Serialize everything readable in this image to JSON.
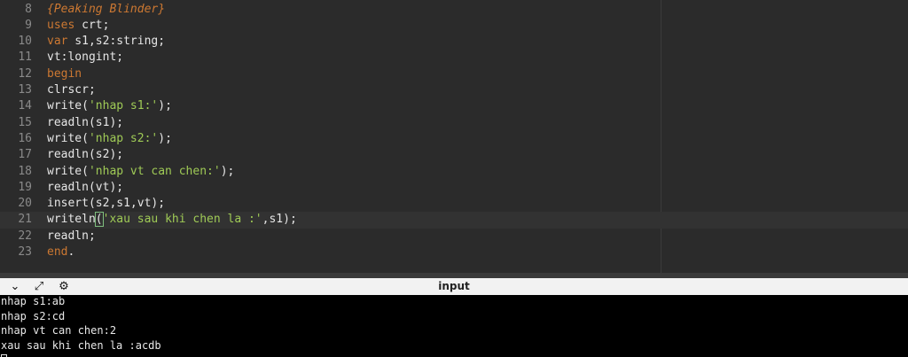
{
  "editor": {
    "lines": [
      {
        "num": "8",
        "tokens": [
          {
            "t": "{Peaking Blinder}",
            "c": "comment"
          }
        ]
      },
      {
        "num": "9",
        "tokens": [
          {
            "t": "uses",
            "c": "kw"
          },
          {
            "t": " crt;",
            "c": "default"
          }
        ]
      },
      {
        "num": "10",
        "tokens": [
          {
            "t": "var",
            "c": "kw"
          },
          {
            "t": " s1,s2:string;",
            "c": "default"
          }
        ]
      },
      {
        "num": "11",
        "tokens": [
          {
            "t": "vt:longint;",
            "c": "default"
          }
        ]
      },
      {
        "num": "12",
        "tokens": [
          {
            "t": "begin",
            "c": "kw"
          }
        ]
      },
      {
        "num": "13",
        "tokens": [
          {
            "t": "clrscr;",
            "c": "default"
          }
        ]
      },
      {
        "num": "14",
        "tokens": [
          {
            "t": "write(",
            "c": "default"
          },
          {
            "t": "'nhap s1:'",
            "c": "str"
          },
          {
            "t": ");",
            "c": "default"
          }
        ]
      },
      {
        "num": "15",
        "tokens": [
          {
            "t": "readln(s1);",
            "c": "default"
          }
        ]
      },
      {
        "num": "16",
        "tokens": [
          {
            "t": "write(",
            "c": "default"
          },
          {
            "t": "'nhap s2:'",
            "c": "str"
          },
          {
            "t": ");",
            "c": "default"
          }
        ]
      },
      {
        "num": "17",
        "tokens": [
          {
            "t": "readln(s2);",
            "c": "default"
          }
        ]
      },
      {
        "num": "18",
        "tokens": [
          {
            "t": "write(",
            "c": "default"
          },
          {
            "t": "'nhap vt can chen:'",
            "c": "str"
          },
          {
            "t": ");",
            "c": "default"
          }
        ]
      },
      {
        "num": "19",
        "tokens": [
          {
            "t": "readln(vt);",
            "c": "default"
          }
        ]
      },
      {
        "num": "20",
        "tokens": [
          {
            "t": "insert(s2,s1,vt);",
            "c": "default"
          }
        ]
      },
      {
        "num": "21",
        "active": true,
        "tokens": [
          {
            "t": "writeln",
            "c": "default"
          },
          {
            "t": "(",
            "c": "bracket"
          },
          {
            "t": "'xau sau khi chen la :'",
            "c": "str"
          },
          {
            "t": ",s1);",
            "c": "default"
          }
        ]
      },
      {
        "num": "22",
        "tokens": [
          {
            "t": "readln;",
            "c": "default"
          }
        ]
      },
      {
        "num": "23",
        "tokens": [
          {
            "t": "end",
            "c": "kw"
          },
          {
            "t": ".",
            "c": "default"
          }
        ]
      }
    ]
  },
  "panel": {
    "title": "input",
    "icons": [
      {
        "name": "chevron-down-icon",
        "glyph": "⌄"
      },
      {
        "name": "expand-icon",
        "glyph": "⤢"
      },
      {
        "name": "settings-icon",
        "glyph": "⚙"
      }
    ]
  },
  "terminal": {
    "lines": [
      "nhap s1:ab",
      "nhap s2:cd",
      "nhap vt can chen:2",
      "xau sau khi chen la :acdb"
    ]
  },
  "colors": {
    "editor_bg": "#2b2b2b",
    "keyword": "#cc7832",
    "string": "#9fca56",
    "text": "#e6e6e6",
    "terminal_bg": "#000000"
  }
}
